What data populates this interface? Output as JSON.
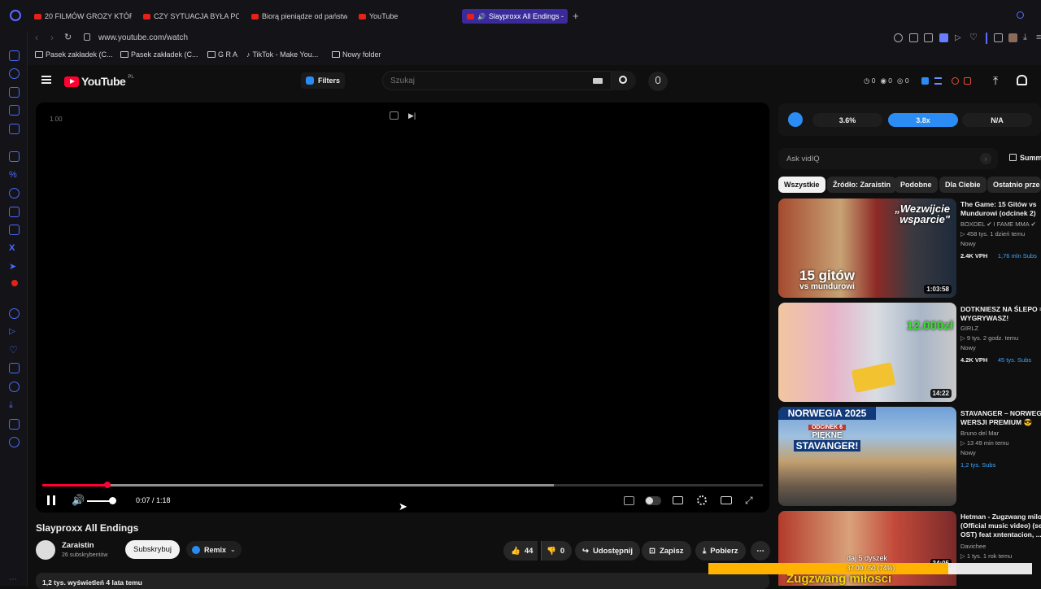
{
  "browser": {
    "tabs": [
      {
        "label": "20 FILMÓW GROZY KTÓRE"
      },
      {
        "label": "CZY SYTUACJA BYŁA POD"
      },
      {
        "label": "Biorą pieniądze od państw"
      },
      {
        "label": "YouTube"
      },
      {
        "label": "Slayproxx All Endings -"
      }
    ],
    "new_tab": "+",
    "url": "www.youtube.com/watch",
    "bookmarks": [
      {
        "label": "Pasek zakładek (C..."
      },
      {
        "label": "Pasek zakładek (C..."
      },
      {
        "label": "G R A"
      },
      {
        "label": "TikTok - Make You..."
      },
      {
        "label": "Nowy folder"
      }
    ]
  },
  "header": {
    "logo": "YouTube",
    "country": "PL",
    "filters_label": "Filters",
    "search_placeholder": "Szukaj",
    "stats": [
      "0",
      "0",
      "0"
    ]
  },
  "player": {
    "speed": "1.00",
    "time": "0:07 / 1:18",
    "progress": 0.09,
    "buffered": 0.71,
    "volume": 0.9
  },
  "video": {
    "title": "Slayproxx All Endings",
    "channel": "Zaraistin",
    "subscribers": "26 subskrybentów",
    "subscribe": "Subskrybuj",
    "remix": "Remix",
    "likes": "44",
    "dislikes": "0",
    "share": "Udostępnij",
    "save": "Zapisz",
    "download": "Pobierz",
    "views": "1,2 tys. wyświetleń  4 lata temu"
  },
  "sidebar": {
    "metrics": [
      "3.6%",
      "3.8x",
      "N/A"
    ],
    "ask": "Ask vidIQ",
    "summary": "Summ",
    "chips": [
      "Wszystkie",
      "Źródło: Zaraistin",
      "Podobne",
      "Dla Ciebie",
      "Ostatnio prze"
    ],
    "videos": [
      {
        "title": "The Game: 15 Gitów vs",
        "title2": "Mundurowi (odcinek 2)",
        "channel": "BOXDEL ✔ I FAME MMA ✔",
        "meta": "▷ 458 tys.  1 dzień temu",
        "badge": "Nowy",
        "vph": "2.4K VPH",
        "subs": "1,76 mln Subs",
        "duration": "1:03:58",
        "overlay1": "„Wezwijcie",
        "overlay2": "wsparcie\"",
        "overlay3": "15 gitów",
        "overlay4": "vs mundurowi"
      },
      {
        "title": "DOTKNIESZ NA ŚLEPO =",
        "title2": "WYGRYWASZ!",
        "channel": "GIRLZ",
        "meta": "▷ 9 tys.  2 godz. temu",
        "badge": "Nowy",
        "vph": "4.2K VPH",
        "subs": "45 tys. Subs",
        "duration": "14:22",
        "overlay1": "12.000zł"
      },
      {
        "title": "STAVANGER – NORWEGI",
        "title2": "WERSJI PREMIUM 😎",
        "channel": "Bruno del Mar",
        "meta": "▷ 13  49 min temu",
        "badge": "Nowy",
        "vph": "",
        "subs": "1,2 tys. Subs",
        "duration": "",
        "overlay1": "NORWEGIA 2025",
        "overlay2": "ODCINEK 6",
        "overlay3": "PIĘKNE",
        "overlay4": "STAVANGER!"
      },
      {
        "title": "Hetman - Zugzwang milo",
        "title2": "(Official music video) (se",
        "title3": "OST) feat xntentacion, ...",
        "channel": "Davichee",
        "meta": "▷ 1 tys.  1 rok temu",
        "duration": "34:05",
        "overlay1": "Zugzwang miłosci"
      }
    ]
  },
  "toast": {
    "line1": "daj 5 dyszek",
    "line2": "37.00 / 50 (74%)",
    "progress": 0.74
  },
  "colors": {
    "accent": "#ff0033",
    "vidiq_blue": "#2b8cf3",
    "tab_active": "#3a2a9b",
    "toast": "#ffb300"
  }
}
